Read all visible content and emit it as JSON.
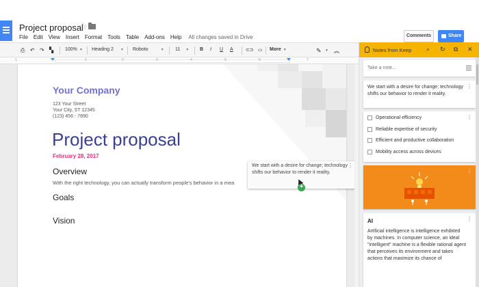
{
  "header": {
    "doc_title": "Project proposal",
    "menu": [
      "File",
      "Edit",
      "View",
      "Insert",
      "Format",
      "Tools",
      "Table",
      "Add-ons",
      "Help"
    ],
    "save_status": "All changes saved in Drive",
    "comments_label": "Comments",
    "share_label": "Share",
    "accent_color": "#4285f4"
  },
  "toolbar": {
    "zoom": "100%",
    "style": "Heading 2",
    "font": "Roboto",
    "font_size": "11",
    "bold": "B",
    "italic": "I",
    "underline": "U",
    "text_color": "A",
    "more": "More"
  },
  "ruler": {
    "numbers": [
      "1",
      "1",
      "2",
      "3",
      "4",
      "5",
      "6",
      "7"
    ]
  },
  "document": {
    "company": "Your Company",
    "address": [
      "123 Your Street",
      "Your City, ST 12345",
      "(123) 456 - 7890"
    ],
    "title": "Project proposal",
    "date": "February 28, 2017",
    "sections": [
      "Overview",
      "Goals",
      "Vision"
    ],
    "overview_text": "With the right technology, you can actually transform people's behavior in a mea",
    "drag_note": "We start with a desire for change; technology shifts our behavior to render it reality."
  },
  "keep": {
    "title": "Notes from Keep",
    "header_color": "#f4b400",
    "take_note_placeholder": "Take a note...",
    "note1": "We start with a desire for change; technology shifts our behavior to render it reality.",
    "checklist": [
      "Operational efficiency",
      "Reliable expertise of security",
      "Efficient and productive collaboration",
      "Mobility access across devices"
    ],
    "ai_title": "AI",
    "ai_text": "Artificial intelligence is intelligence exhibited by machines. In computer science, an ideal \"intelligent\" machine is a flexible rational agent that perceives its environment and takes actions that maximize its chance of"
  }
}
